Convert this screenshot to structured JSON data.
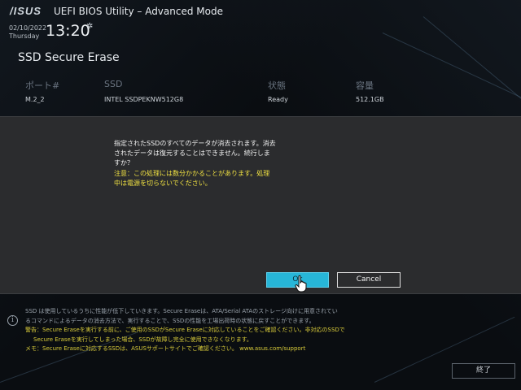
{
  "header": {
    "logo": "/ISUS",
    "app_title": "UEFI BIOS Utility – Advanced Mode",
    "date": "02/10/2022",
    "weekday": "Thursday",
    "time": "13:20"
  },
  "page_title": "SSD Secure Erase",
  "table": {
    "columns": [
      "ポート#",
      "SSD",
      "状態",
      "容量"
    ],
    "rows": [
      [
        "M.2_2",
        "INTEL SSDPEKNW512G8",
        "Ready",
        "512.1GB"
      ]
    ]
  },
  "dialog": {
    "message_lines": [
      "指定されたSSDのすべてのデータが消去されます。消去",
      "されたデータは復元することはできません。続行しま",
      "すか？"
    ],
    "warning_lines": [
      "注意：この処理には数分かかることがあります。処理",
      "中は電源を切らないでください。"
    ],
    "ok_label": "Ok",
    "cancel_label": "Cancel"
  },
  "info": {
    "lines": [
      "SSD は使用しているうちに性能が低下していきます。Secure Eraseは、ATA/Serial ATAのストレージ向けに用意されてい",
      "るコマンドによるデータの消去方法で、実行することで、SSDの性能を工場出荷時の状態に戻すことができます。",
      "警告：Secure Eraseを実行する前に、ご使用のSSDがSecure Eraseに対応していることをご確認ください。非対応のSSDで",
      "Secure Eraseを実行してしまった場合、SSDが故障し完全に使用できなくなります。",
      "メモ：Secure Eraseに対応するSSDは、ASUSサポートサイトでご確認ください。 www.asus.com/support"
    ]
  },
  "footer": {
    "exit_label": "終了"
  },
  "colors": {
    "accent": "#27b6d8",
    "warning": "#f0e142",
    "dialog_bg": "#2b2c2e"
  }
}
